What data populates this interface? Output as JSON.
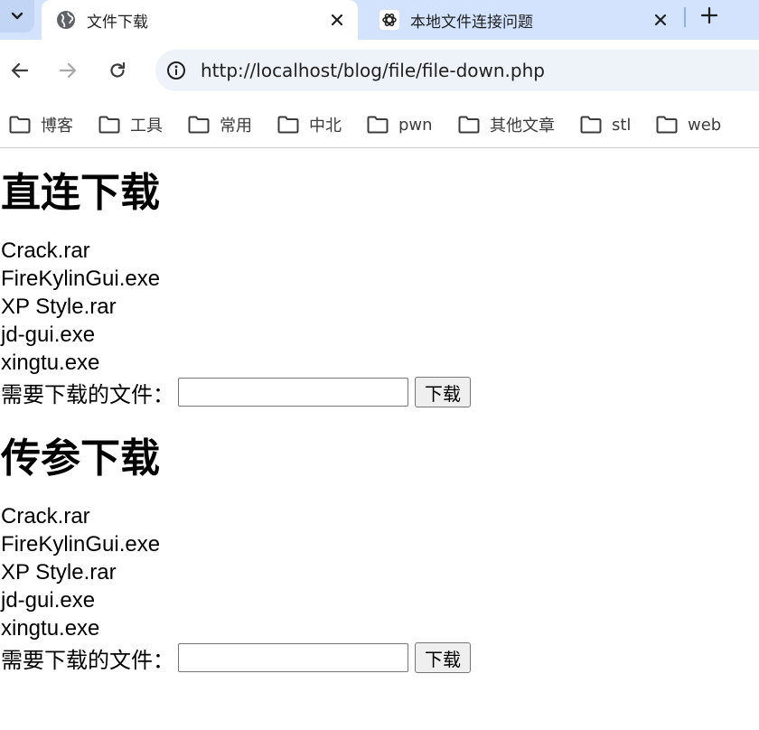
{
  "browser": {
    "tabs": [
      {
        "title": "文件下载",
        "icon": "globe-icon",
        "active": true
      },
      {
        "title": "本地文件连接问题",
        "icon": "openai-logo-icon",
        "active": false
      }
    ],
    "address_bar": {
      "url": "http://localhost/blog/file/file-down.php"
    },
    "bookmarks": [
      {
        "label": "博客"
      },
      {
        "label": "工具"
      },
      {
        "label": "常用"
      },
      {
        "label": "中北"
      },
      {
        "label": "pwn"
      },
      {
        "label": "其他文章"
      },
      {
        "label": "stl"
      },
      {
        "label": "web"
      }
    ]
  },
  "sections": [
    {
      "title": "直连下载",
      "files": [
        "Crack.rar",
        "FireKylinGui.exe",
        "XP Style.rar",
        "jd-gui.exe",
        "xingtu.exe"
      ],
      "form": {
        "label": "需要下载的文件：",
        "input_value": "",
        "button": "下载"
      }
    },
    {
      "title": "传参下载",
      "files": [
        "Crack.rar",
        "FireKylinGui.exe",
        "XP Style.rar",
        "jd-gui.exe",
        "xingtu.exe"
      ],
      "form": {
        "label": "需要下载的文件：",
        "input_value": "",
        "button": "下载"
      }
    }
  ],
  "colors": {
    "tabstrip_bg": "#d3e3fd",
    "omnibox_bg": "#eef2f9",
    "page_bg": "#ffffff"
  }
}
